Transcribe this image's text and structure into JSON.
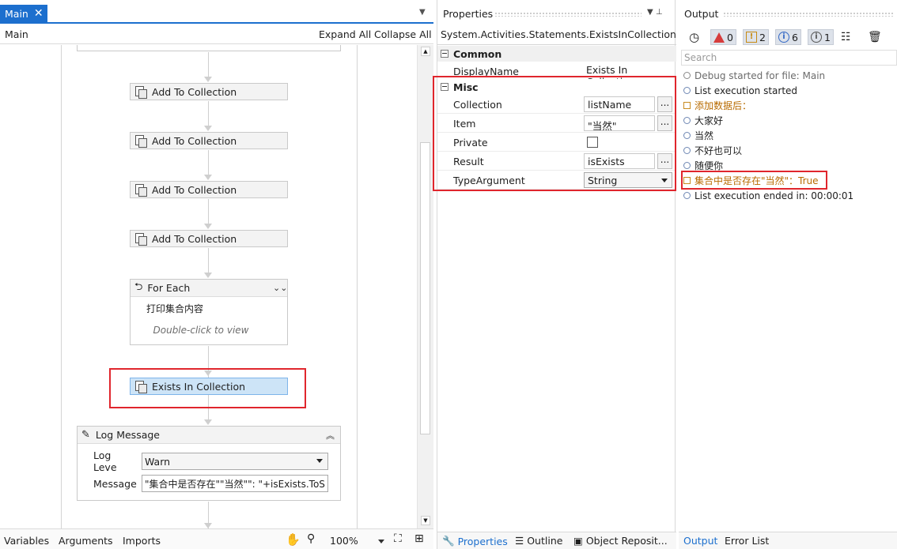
{
  "designer": {
    "tab_label": "Main",
    "tab_close": "✕",
    "breadcrumb": "Main",
    "expand_all": "Expand All",
    "collapse_all": "Collapse All",
    "activities": [
      {
        "label": "Add To Collection"
      },
      {
        "label": "Add To Collection"
      },
      {
        "label": "Add To Collection"
      },
      {
        "label": "Add To Collection"
      }
    ],
    "for_each": {
      "title": "For Each",
      "body": "打印集合内容",
      "hint": "Double-click to view"
    },
    "exists_in_collection": {
      "label": "Exists In Collection"
    },
    "log_message": {
      "title": "Log Message",
      "level_label": "Log Leve",
      "level_value": "Warn",
      "message_label": "Message",
      "message_value": "\"集合中是否存在\"\"当然\"\": \"+isExists.ToS"
    },
    "bottom_bar": {
      "variables": "Variables",
      "arguments": "Arguments",
      "imports": "Imports",
      "zoom": "100%"
    }
  },
  "properties": {
    "title": "Properties",
    "class_name": "System.Activities.Statements.ExistsInCollection<...",
    "common": {
      "label": "Common",
      "display_name_label": "DisplayName",
      "display_name_value": "Exists In Collection"
    },
    "misc": {
      "label": "Misc",
      "collection_label": "Collection",
      "collection_value": "listName",
      "item_label": "Item",
      "item_value": "\"当然\"",
      "private_label": "Private",
      "result_label": "Result",
      "result_value": "isExists",
      "type_argument_label": "TypeArgument",
      "type_argument_value": "String"
    },
    "ellipsis": "...",
    "tabs": {
      "properties": "Properties",
      "outline": "Outline",
      "object_repo": "Object Reposit..."
    }
  },
  "output": {
    "title": "Output",
    "filters": {
      "errors": "0",
      "warnings": "2",
      "info": "6",
      "trace": "1"
    },
    "search_placeholder": "Search",
    "lines": [
      {
        "text": "Debug started for file: Main",
        "kind": "muted"
      },
      {
        "text": "List execution started",
        "kind": "info"
      },
      {
        "text": "添加数据后：",
        "kind": "warn"
      },
      {
        "text": "大家好",
        "kind": "info"
      },
      {
        "text": "当然",
        "kind": "info"
      },
      {
        "text": "不好也可以",
        "kind": "info"
      },
      {
        "text": "随便你",
        "kind": "info"
      },
      {
        "text": "集合中是否存在\"当然\"：True",
        "kind": "warn"
      },
      {
        "text": "List execution ended in: 00:00:01",
        "kind": "info"
      }
    ],
    "tabs": {
      "output": "Output",
      "error_list": "Error List"
    }
  },
  "colors": {
    "accent": "#1c6fce",
    "highlight": "#e0262d",
    "warning": "#b86b00"
  }
}
